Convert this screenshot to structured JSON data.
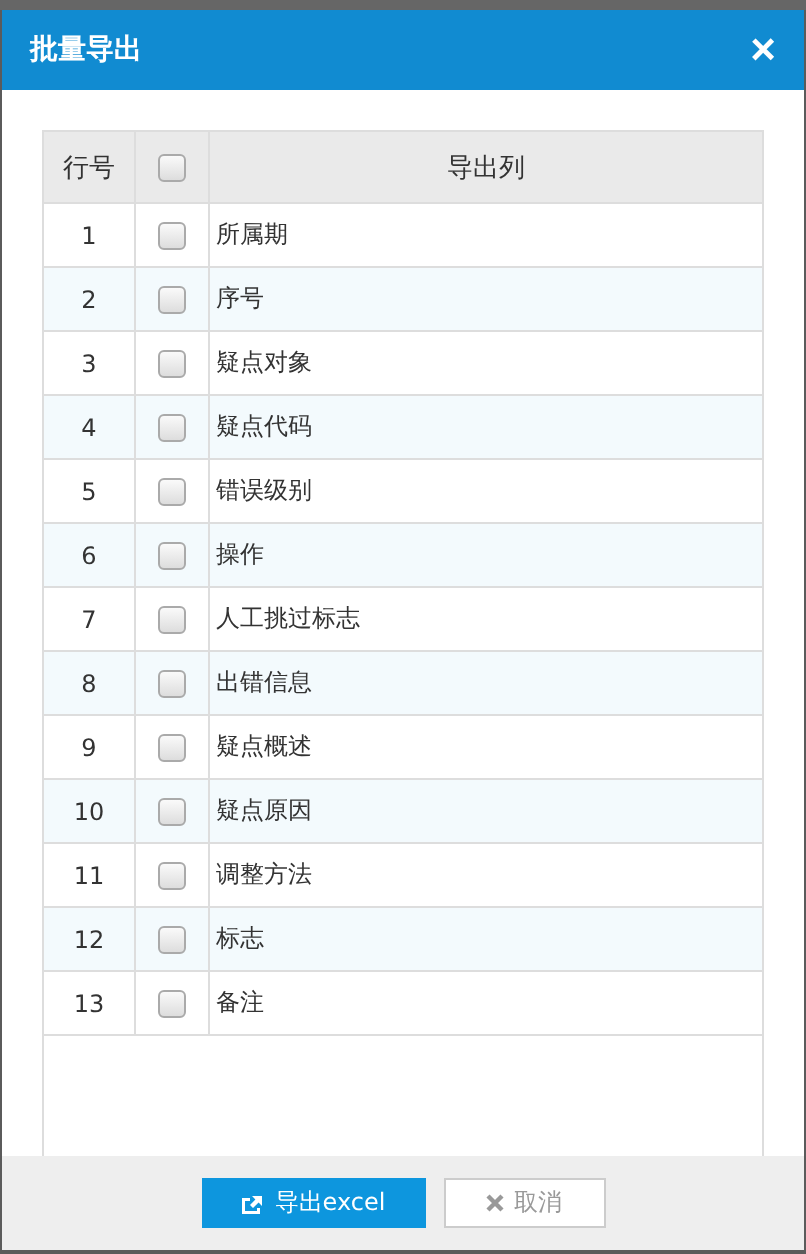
{
  "dialog": {
    "title": "批量导出",
    "close": "×"
  },
  "table": {
    "columns": [
      "行号",
      "导出列"
    ],
    "header_checked": false,
    "rows": [
      {
        "index": "1",
        "checked": false,
        "name": "所属期"
      },
      {
        "index": "2",
        "checked": false,
        "name": "序号"
      },
      {
        "index": "3",
        "checked": false,
        "name": "疑点对象"
      },
      {
        "index": "4",
        "checked": false,
        "name": "疑点代码"
      },
      {
        "index": "5",
        "checked": false,
        "name": "错误级别"
      },
      {
        "index": "6",
        "checked": false,
        "name": "操作"
      },
      {
        "index": "7",
        "checked": false,
        "name": "人工挑过标志"
      },
      {
        "index": "8",
        "checked": false,
        "name": "出错信息"
      },
      {
        "index": "9",
        "checked": false,
        "name": "疑点概述"
      },
      {
        "index": "10",
        "checked": false,
        "name": "疑点原因"
      },
      {
        "index": "11",
        "checked": false,
        "name": "调整方法"
      },
      {
        "index": "12",
        "checked": false,
        "name": "标志"
      },
      {
        "index": "13",
        "checked": false,
        "name": "备注"
      }
    ]
  },
  "buttons": {
    "export": "导出excel",
    "cancel": "取消"
  }
}
